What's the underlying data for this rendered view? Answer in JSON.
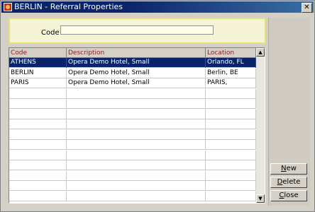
{
  "window": {
    "title": "BERLIN - Referral Properties",
    "close_glyph": "✕"
  },
  "search": {
    "code_label": "Code",
    "code_value": ""
  },
  "table": {
    "headers": [
      "Code",
      "Description",
      "Location"
    ],
    "rows": [
      [
        "ATHENS",
        "Opera Demo Hotel, Small",
        "Orlando, FL"
      ],
      [
        "BERLIN",
        "Opera Demo Hotel, Small",
        "Berlin, BE"
      ],
      [
        "PARIS",
        "Opera Demo Hotel, Small",
        "PARIS,"
      ]
    ],
    "selected_row": 0
  },
  "buttons": {
    "new": {
      "accel": "N",
      "rest": "ew"
    },
    "delete": {
      "accel": "D",
      "rest": "elete"
    },
    "close": {
      "accel": "C",
      "rest": "lose"
    }
  },
  "colors": {
    "title_bar": "#0a246a",
    "header_text": "#8b1a1a",
    "selection": "#0a246a",
    "search_panel": "#f5f3d6"
  },
  "icons": {
    "app": "hotel-app-icon",
    "scroll_up": "scroll-up-arrow-icon",
    "scroll_down": "scroll-down-arrow-icon"
  }
}
